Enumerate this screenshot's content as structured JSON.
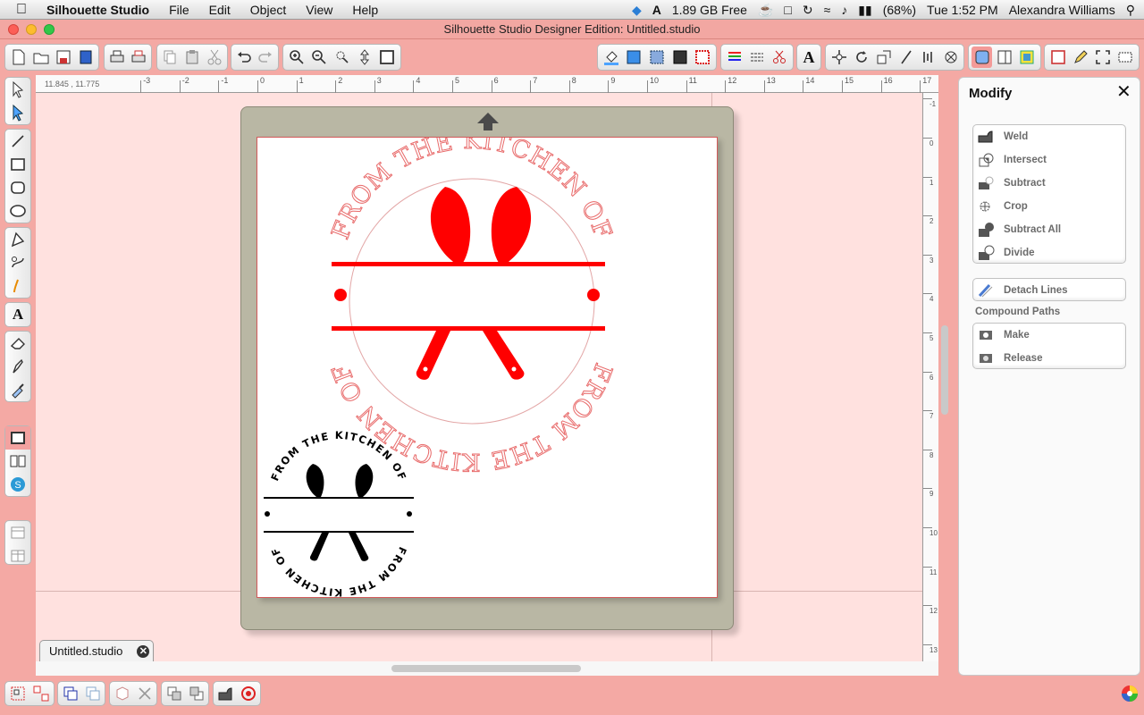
{
  "menubar": {
    "app_name": "Silhouette Studio",
    "menus": [
      "File",
      "Edit",
      "Object",
      "View",
      "Help"
    ],
    "memory": "1.89 GB Free",
    "battery": "(68%)",
    "clock": "Tue 1:52 PM",
    "user": "Alexandra Williams"
  },
  "window": {
    "title": "Silhouette Studio Designer Edition: Untitled.studio"
  },
  "ruler": {
    "coords": "11.845 , 11.775",
    "top_ticks": [
      "-3",
      "-2",
      "-1",
      "0",
      "1",
      "2",
      "3",
      "4",
      "5",
      "6",
      "7",
      "8",
      "9",
      "10",
      "11",
      "12",
      "13",
      "14",
      "15",
      "16",
      "17"
    ],
    "right_ticks": [
      "-1",
      "0",
      "1",
      "2",
      "3",
      "4",
      "5",
      "6",
      "7",
      "8",
      "9",
      "10",
      "11",
      "12",
      "13"
    ]
  },
  "design": {
    "large_text": "FROM THE KITCHEN OF",
    "small_text": "FROM THE KITCHEN OF",
    "large_color": "#ff0000",
    "small_color": "#000000",
    "outline_color": "#e86a6a"
  },
  "doc_tab": {
    "label": "Untitled.studio",
    "close": "✕"
  },
  "modify_panel": {
    "title": "Modify",
    "close": "✕",
    "operations": [
      "Weld",
      "Intersect",
      "Subtract",
      "Crop",
      "Subtract All",
      "Divide"
    ],
    "detach": "Detach Lines",
    "compound_label": "Compound Paths",
    "compound": [
      "Make",
      "Release"
    ]
  },
  "colors": {
    "chrome": "#f4a9a4",
    "mat": "#b9b7a4",
    "canvas": "#ffe1df"
  }
}
